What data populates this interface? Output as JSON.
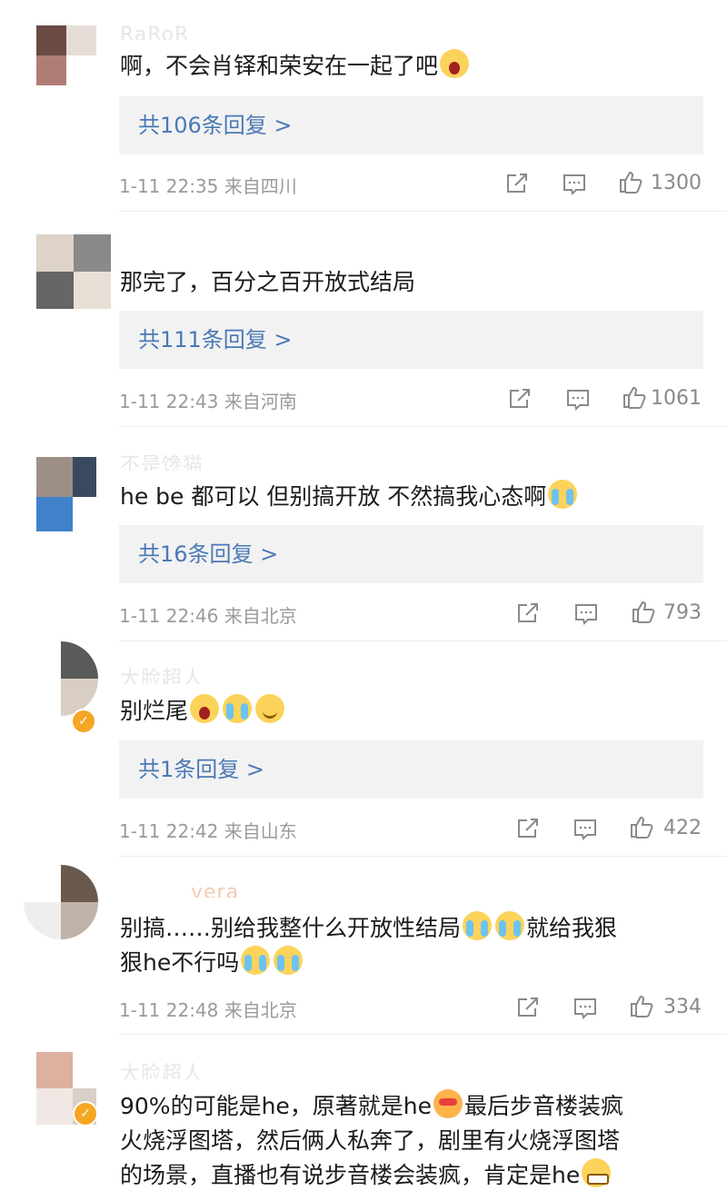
{
  "comments": [
    {
      "username": "RaRoR_",
      "text": "啊，不会肖铎和荣安在一起了吧",
      "replies": "共106条回复 >",
      "time": "1-11 22:35",
      "location": "来自四川",
      "likes": "1300",
      "emoji": [
        "scream"
      ]
    },
    {
      "username": "",
      "text": "那完了，百分之百开放式结局",
      "replies": "共111条回复 >",
      "time": "1-11 22:43",
      "location": "来自河南",
      "likes": "1061",
      "emoji": []
    },
    {
      "username": "不是馋猫",
      "text": "he be 都可以 但别搞开放 不然搞我心态啊",
      "replies": "共16条回复 >",
      "time": "1-11 22:46",
      "location": "来自北京",
      "likes": "793",
      "emoji": [
        "cry"
      ]
    },
    {
      "username": "大脸超人",
      "text": "别烂尾",
      "replies": "共1条回复 >",
      "time": "1-11 22:42",
      "location": "来自山东",
      "likes": "422",
      "emoji": [
        "scream",
        "cry",
        "smile"
      ]
    },
    {
      "username": "vera",
      "text_line1": "别搞……别给我整什么开放性结局",
      "text_line1_tail": "就给我狠",
      "text_line2": "狠he不行吗",
      "time": "1-11 22:48",
      "location": "来自北京",
      "likes": "334"
    },
    {
      "username": "大脸超人",
      "text_line1": "90%的可能是he，原著就是he",
      "text_line1_tail": "最后步音楼装疯",
      "text_line2": "火烧浮图塔，然后俩人私奔了，剧里有火烧浮图塔",
      "text_line3": "的场景，直播也有说步音楼会装疯，肯定是he"
    }
  ],
  "icons": {
    "share": "share-icon",
    "comment": "comment-icon",
    "like": "thumbs-up-icon",
    "verified": "verified-badge-icon"
  },
  "colors": {
    "reply_link": "#4a79b5",
    "reply_bg": "#f2f2f2",
    "meta": "#9a9a9a",
    "verified": "#f5a623"
  }
}
